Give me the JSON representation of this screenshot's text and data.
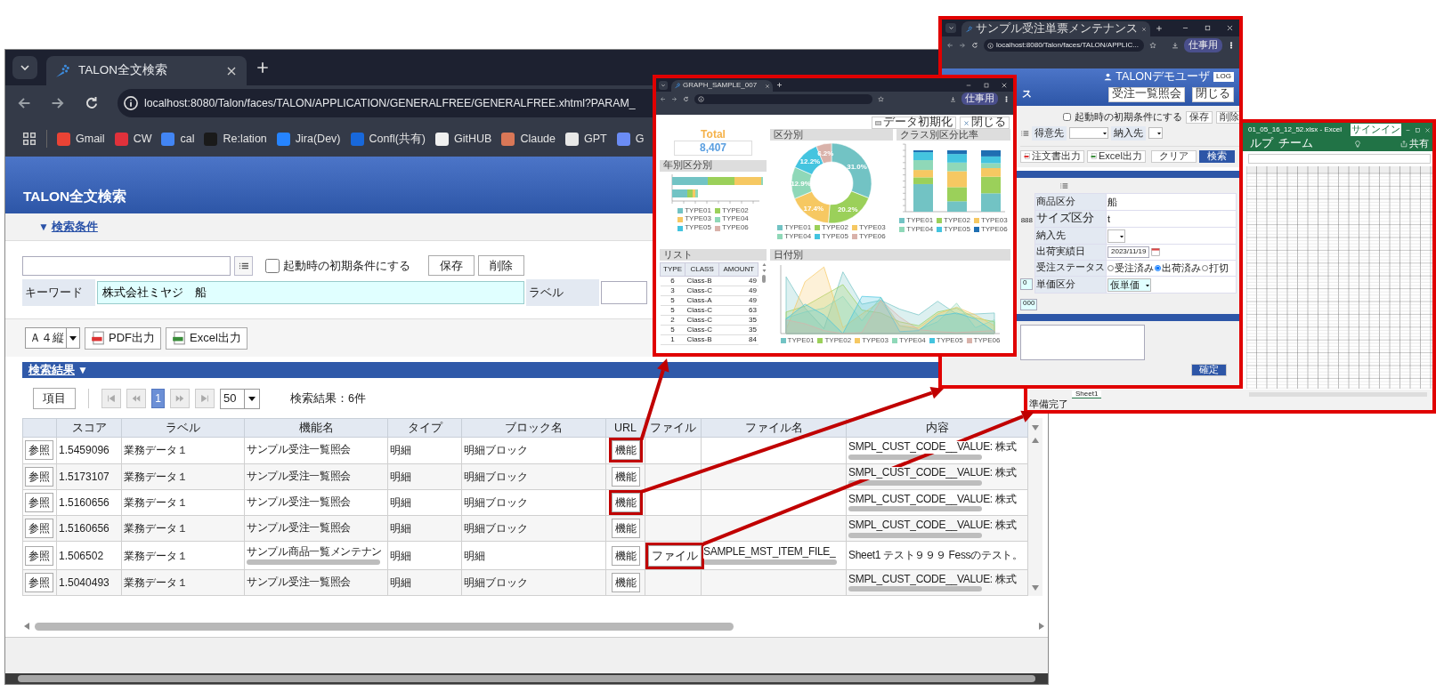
{
  "main_window": {
    "tab_title": "TALON全文検索",
    "url": "localhost:8080/Talon/faces/TALON/APPLICATION/GENERALFREE/GENERALFREE.xhtml?PARAM_",
    "bookmarks": [
      {
        "label": "Gmail",
        "color": "#ea4335"
      },
      {
        "label": "CW",
        "color": "#e0313b"
      },
      {
        "label": "cal",
        "color": "#4285f4"
      },
      {
        "label": "Re:lation",
        "color": "#1a1a1a"
      },
      {
        "label": "Jira(Dev)",
        "color": "#2684ff"
      },
      {
        "label": "Confl(共有)",
        "color": "#1868db"
      },
      {
        "label": "GitHUB",
        "color": "#f0f0f0"
      },
      {
        "label": "Claude",
        "color": "#d97757"
      },
      {
        "label": "GPT",
        "color": "#e8e8e8"
      },
      {
        "label": "G",
        "color": "#6b8cf5"
      }
    ]
  },
  "app": {
    "title": "TALON全文検索",
    "conditions_toggle": "▼",
    "conditions_link": "検索条件"
  },
  "search_form": {
    "init_checkbox": {
      "label": "起動時の初期条件にする",
      "checked": false
    },
    "buttons": [
      "保存",
      "削除"
    ],
    "keyword": {
      "label": "キーワード",
      "value": "株式会社ミヤジ　船"
    },
    "label_field": {
      "label": "ラベル"
    }
  },
  "output_bar": {
    "paper": "Ａ４縦",
    "buttons": [
      {
        "label": "PDF出力",
        "kind": "pdf"
      },
      {
        "label": "Excel出力",
        "kind": "excel"
      }
    ]
  },
  "results": {
    "title": "検索結果",
    "toggle": "▼",
    "columns_button": "項目",
    "pages": [
      {
        "label": "1",
        "selected": true
      }
    ],
    "page_size": "50",
    "summary": "検索結果：6件",
    "columns": [
      "スコア",
      "ラベル",
      "機能名",
      "タイプ",
      "ブロック名",
      "URL",
      "ファイル",
      "ファイル名",
      "内容"
    ],
    "rows": [
      {
        "open": "参照",
        "score": "1.5459096",
        "label": "業務データ１",
        "name": {
          "text": "サンプル受注一覧照会",
          "overflow": false
        },
        "type": "明細",
        "block": "明細ブロック",
        "url": {
          "label": "機能",
          "highlighted": true
        },
        "content": {
          "text": "SMPL_CUST_CODE__VALUE: 株式",
          "overflow": true
        }
      },
      {
        "open": "参照",
        "score": "1.5173107",
        "label": "業務データ１",
        "name": {
          "text": "サンプル受注一覧照会",
          "overflow": false
        },
        "type": "明細",
        "block": "明細ブロック",
        "url": {
          "label": "機能",
          "highlighted": false
        },
        "content": {
          "text": "SMPL_CUST_CODE__VALUE: 株式",
          "overflow": true
        }
      },
      {
        "open": "参照",
        "score": "1.5160656",
        "label": "業務データ１",
        "name": {
          "text": "サンプル受注一覧照会",
          "overflow": false
        },
        "type": "明細",
        "block": "明細ブロック",
        "url": {
          "label": "機能",
          "highlighted": true
        },
        "content": {
          "text": "SMPL_CUST_CODE__VALUE: 株式",
          "overflow": true
        }
      },
      {
        "open": "参照",
        "score": "1.5160656",
        "label": "業務データ１",
        "name": {
          "text": "サンプル受注一覧照会",
          "overflow": false
        },
        "type": "明細",
        "block": "明細ブロック",
        "url": {
          "label": "機能",
          "highlighted": false
        },
        "content": {
          "text": "SMPL_CUST_CODE__VALUE: 株式",
          "overflow": true
        }
      },
      {
        "open": "参照",
        "score": "1.506502",
        "label": "業務データ１",
        "name": {
          "text": "サンプル商品一覧メンテナン",
          "overflow": true
        },
        "type": "明細",
        "block": "明細",
        "url": {
          "label": "機能",
          "highlighted": false
        },
        "file": {
          "label": "ファイル",
          "highlighted": true
        },
        "file_name": {
          "text": "SAMPLE_MST_ITEM_FILE_",
          "overflow": true
        },
        "content": {
          "text": "Sheet1 テスト９９９ Fessのテスト。",
          "overflow": false
        }
      },
      {
        "open": "参照",
        "score": "1.5040493",
        "label": "業務データ１",
        "name": {
          "text": "サンプル受注一覧照会",
          "overflow": false
        },
        "type": "明細",
        "block": "明細ブロック",
        "url": {
          "label": "機能",
          "highlighted": false
        },
        "content": {
          "text": "SMPL_CUST_CODE__VALUE: 株式",
          "overflow": true
        }
      }
    ]
  },
  "graph_window": {
    "tab_title": "GRAPH_SAMPLE_007",
    "profile": "仕事用",
    "buttons": [
      "データ初期化",
      "閉じる"
    ],
    "total": {
      "label": "Total",
      "value": "8,407"
    },
    "year_panel": {
      "title": "年別区分別",
      "legend": [
        {
          "name": "TYPE01",
          "color": "#72c3c4"
        },
        {
          "name": "TYPE02",
          "color": "#9bd05a"
        },
        {
          "name": "TYPE03",
          "color": "#f6c862"
        },
        {
          "name": "TYPE04",
          "color": "#8fd8b8"
        },
        {
          "name": "TYPE05",
          "color": "#44c4df"
        },
        {
          "name": "TYPE06",
          "color": "#d9b2aa"
        }
      ]
    },
    "category_panel": {
      "chart_data": {
        "type": "donut",
        "title": "区分別",
        "categories": [
          "TYPE01",
          "TYPE02",
          "TYPE03",
          "TYPE04",
          "TYPE05",
          "TYPE06"
        ],
        "values": [
          31.0,
          20.2,
          17.4,
          12.9,
          12.2,
          6.2
        ],
        "value_labels": [
          "31.0%",
          "20.2%",
          "17.4%",
          "12.9%",
          "12.2%",
          "6.2%"
        ]
      }
    },
    "class_panel": {
      "title": "クラス別区分比率",
      "legend": [
        {
          "name": "TYPE01",
          "color": "#72c3c4"
        },
        {
          "name": "TYPE02",
          "color": "#9bd05a"
        },
        {
          "name": "TYPE03",
          "color": "#f6c862"
        },
        {
          "name": "TYPE04",
          "color": "#8fd8b8"
        },
        {
          "name": "TYPE05",
          "color": "#44c4df"
        },
        {
          "name": "TYPE06",
          "color": "#1f6fb2"
        }
      ]
    },
    "list": {
      "title": "リスト",
      "columns": [
        "TYPE",
        "CLASS",
        "AMOUNT"
      ],
      "rows": [
        [
          "6",
          "Class-B",
          "49"
        ],
        [
          "3",
          "Class-C",
          "49"
        ],
        [
          "5",
          "Class-A",
          "49"
        ],
        [
          "5",
          "Class-C",
          "63"
        ],
        [
          "2",
          "Class-C",
          "35"
        ],
        [
          "5",
          "Class-C",
          "35"
        ],
        [
          "1",
          "Class-B",
          "84"
        ]
      ]
    },
    "date_panel": {
      "title": "日付別",
      "legend": [
        {
          "name": "TYPE01",
          "color": "#72c3c4"
        },
        {
          "name": "TYPE02",
          "color": "#9bd05a"
        },
        {
          "name": "TYPE03",
          "color": "#f6c862"
        },
        {
          "name": "TYPE04",
          "color": "#8fd8b8"
        },
        {
          "name": "TYPE05",
          "color": "#44c4df"
        },
        {
          "name": "TYPE06",
          "color": "#d9b2aa"
        }
      ]
    }
  },
  "order_window": {
    "tab_title": "サンプル受注単票メンテナンス",
    "url": "localhost:8080/Talon/faces/TALON/APPLIC...",
    "profile": "仕事用",
    "user": "TALONデモユーザ",
    "logout": "LOG",
    "title": "ス",
    "header_buttons": [
      "受注一覧照会",
      "閉じる"
    ],
    "init_checkbox": {
      "label": "起動時の初期条件にする",
      "checked": false
    },
    "form_buttons": [
      "保存",
      "削除"
    ],
    "filters": [
      "得意先",
      "納入先"
    ],
    "toolbar": [
      "注文書出力",
      "Excel出力"
    ],
    "actions": [
      {
        "label": "クリア",
        "primary": false
      },
      {
        "label": "検索",
        "primary": true
      }
    ],
    "fields": [
      {
        "kind": "text",
        "label": "商品区分",
        "value": "船"
      },
      {
        "kind": "text",
        "prefix": "888",
        "label": "サイズ区分",
        "value": "t"
      },
      {
        "kind": "select",
        "label": "納入先"
      },
      {
        "kind": "date",
        "label": "出荷実績日",
        "value": "2023/11/19"
      },
      {
        "kind": "radio",
        "label": "受注ステータス",
        "options": [
          {
            "label": "受注済み",
            "selected": false
          },
          {
            "label": "出荷済み",
            "selected": true
          },
          {
            "label": "打切",
            "selected": false
          }
        ]
      },
      {
        "kind": "select",
        "prefix": "0",
        "label": "単価区分",
        "value": "仮単価"
      }
    ],
    "extra_value": "000",
    "confirm": "確定"
  },
  "excel_window": {
    "title": "01_05_16_12_52.xlsx - Excel",
    "sign_in": "サインイン",
    "ribbon_tabs": [
      "ルプ",
      "チーム"
    ],
    "share": "共有",
    "sheet": "Sheet1",
    "status": "準備完了"
  }
}
